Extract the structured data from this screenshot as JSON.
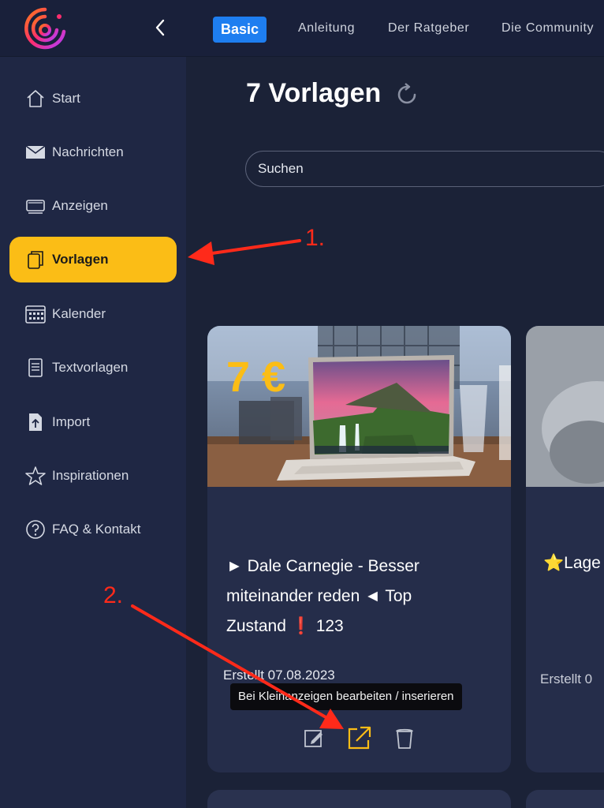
{
  "header": {
    "logo_name": "app-logo",
    "back_icon": "chevron-left-icon",
    "nav": [
      {
        "label": "Basic"
      },
      {
        "label": "Anleitung"
      },
      {
        "label": "Der Ratgeber"
      },
      {
        "label": "Die Community"
      }
    ]
  },
  "sidebar": {
    "items": [
      {
        "label": "Start",
        "icon": "home-icon"
      },
      {
        "label": "Nachrichten",
        "icon": "mail-icon"
      },
      {
        "label": "Anzeigen",
        "icon": "ads-icon"
      },
      {
        "label": "Vorlagen",
        "icon": "templates-icon",
        "active": true
      },
      {
        "label": "Kalender",
        "icon": "calendar-icon"
      },
      {
        "label": "Textvorlagen",
        "icon": "document-icon"
      },
      {
        "label": "Import",
        "icon": "import-icon"
      },
      {
        "label": "Inspirationen",
        "icon": "star-icon"
      },
      {
        "label": "FAQ & Kontakt",
        "icon": "question-icon"
      }
    ]
  },
  "main": {
    "title": "7 Vorlagen",
    "search": {
      "placeholder": "Suchen"
    },
    "cards": [
      {
        "price": "7 €",
        "title": "► Dale Carnegie - Besser miteinander reden ◄ Top Zustand ❗ 123",
        "date": "Erstellt 07.08.2023",
        "tooltip": "Bei Kleinanzeigen bearbeiten / inserieren"
      },
      {
        "title": "⭐Lage",
        "date": "Erstellt 0"
      }
    ]
  },
  "annotations": {
    "step1": "1.",
    "step2": "2."
  },
  "colors": {
    "accent": "#fbbd16",
    "brand_blue": "#1e7ef0",
    "annotation": "#ff2a1a",
    "background": "#1b2237"
  }
}
